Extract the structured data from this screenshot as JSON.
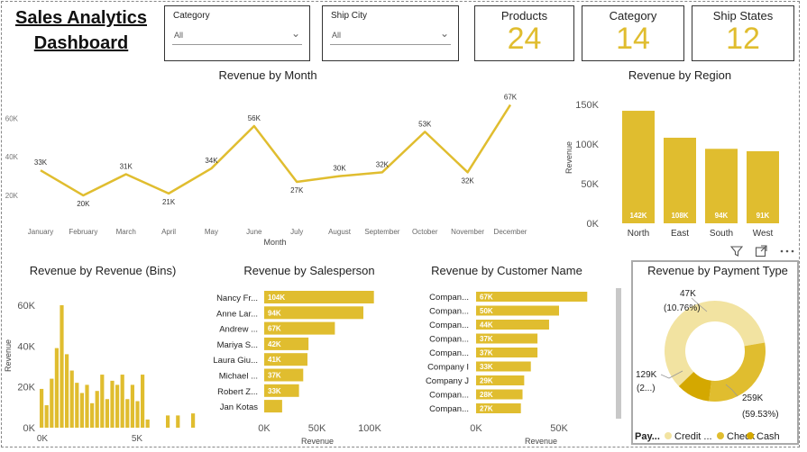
{
  "header": {
    "title": "Sales Analytics Dashboard"
  },
  "filters": [
    {
      "label": "Category",
      "value": "All"
    },
    {
      "label": "Ship City",
      "value": "All"
    }
  ],
  "cards": [
    {
      "label": "Products",
      "value": "24"
    },
    {
      "label": "Category",
      "value": "14"
    },
    {
      "label": "Ship States",
      "value": "12"
    }
  ],
  "colors": {
    "accent": "#E0BD2F",
    "accent_dark": "#D4A800",
    "light": "#F2E3A1"
  },
  "visual_icons": [
    "filter-icon",
    "focus-mode-icon",
    "more-options-icon"
  ],
  "chart_data": [
    {
      "type": "line",
      "title": "Revenue by Month",
      "xlabel": "Month",
      "ylabel": "",
      "categories": [
        "January",
        "February",
        "March",
        "April",
        "May",
        "June",
        "July",
        "August",
        "September",
        "October",
        "November",
        "December"
      ],
      "values": [
        33,
        20,
        31,
        21,
        34,
        56,
        27,
        30,
        32,
        53,
        32,
        67
      ],
      "data_labels": [
        "33K",
        "20K",
        "31K",
        "21K",
        "34K",
        "56K",
        "27K",
        "30K",
        "32K",
        "53K",
        "32K",
        "67K"
      ],
      "yticks": [
        "20K",
        "40K",
        "60K"
      ],
      "ylim": [
        13,
        70
      ],
      "unit": "K"
    },
    {
      "type": "bar",
      "title": "Revenue by Region",
      "ylabel": "Revenue",
      "categories": [
        "North",
        "East",
        "South",
        "West"
      ],
      "values": [
        142,
        108,
        94,
        91
      ],
      "data_labels": [
        "142K",
        "108K",
        "94K",
        "91K"
      ],
      "yticks": [
        "0K",
        "50K",
        "100K",
        "150K"
      ],
      "ylim": [
        0,
        150
      ],
      "unit": "K"
    },
    {
      "type": "bar",
      "title": "Revenue by Revenue (Bins)",
      "ylabel": "Revenue",
      "xticks": [
        "0K",
        "5K"
      ],
      "yticks": [
        "0K",
        "20K",
        "40K",
        "60K"
      ],
      "ylim": [
        0,
        60
      ],
      "values": [
        19,
        11,
        24,
        39,
        60,
        36,
        28,
        22,
        17,
        21,
        12,
        18,
        26,
        14,
        23,
        21,
        26,
        14,
        21,
        13,
        26,
        4,
        0,
        0,
        0,
        6,
        0,
        6,
        0,
        0,
        7
      ],
      "unit": "K"
    },
    {
      "type": "bar",
      "orientation": "horizontal",
      "title": "Revenue by Salesperson",
      "xlabel": "Revenue",
      "categories": [
        "Nancy Fr...",
        "Anne Lar...",
        "Andrew ...",
        "Mariya S...",
        "Laura Giu...",
        "Michael ...",
        "Robert Z...",
        "Jan Kotas"
      ],
      "values": [
        104,
        94,
        67,
        42,
        41,
        37,
        33,
        17
      ],
      "data_labels": [
        "104K",
        "94K",
        "67K",
        "42K",
        "41K",
        "37K",
        "33K",
        ""
      ],
      "xticks": [
        "0K",
        "50K",
        "100K"
      ],
      "xlim": [
        0,
        100
      ],
      "unit": "K"
    },
    {
      "type": "bar",
      "orientation": "horizontal",
      "title": "Revenue by Customer Name",
      "xlabel": "Revenue",
      "categories": [
        "Compan...",
        "Compan...",
        "Compan...",
        "Compan...",
        "Compan...",
        "Company I",
        "Company J",
        "Compan...",
        "Compan..."
      ],
      "values": [
        67,
        50,
        44,
        37,
        37,
        33,
        29,
        28,
        27
      ],
      "data_labels": [
        "67K",
        "50K",
        "44K",
        "37K",
        "37K",
        "33K",
        "29K",
        "28K",
        "27K"
      ],
      "xticks": [
        "0K",
        "50K"
      ],
      "xlim": [
        0,
        50
      ],
      "unit": "K"
    },
    {
      "type": "pie",
      "title": "Revenue by Payment Type",
      "legend_title": "Pay...",
      "categories": [
        "Credit ...",
        "Check",
        "Cash"
      ],
      "values": [
        259,
        129,
        47
      ],
      "percents": [
        59.53,
        29.71,
        10.76
      ],
      "labels": [
        {
          "value": "259K",
          "pct": "(59.53%)"
        },
        {
          "value": "129K",
          "pct": "(2...)"
        },
        {
          "value": "47K",
          "pct": "(10.76%)"
        }
      ],
      "colors": [
        "#F2E3A1",
        "#E0BD2F",
        "#D4A800"
      ],
      "unit": "K"
    }
  ]
}
